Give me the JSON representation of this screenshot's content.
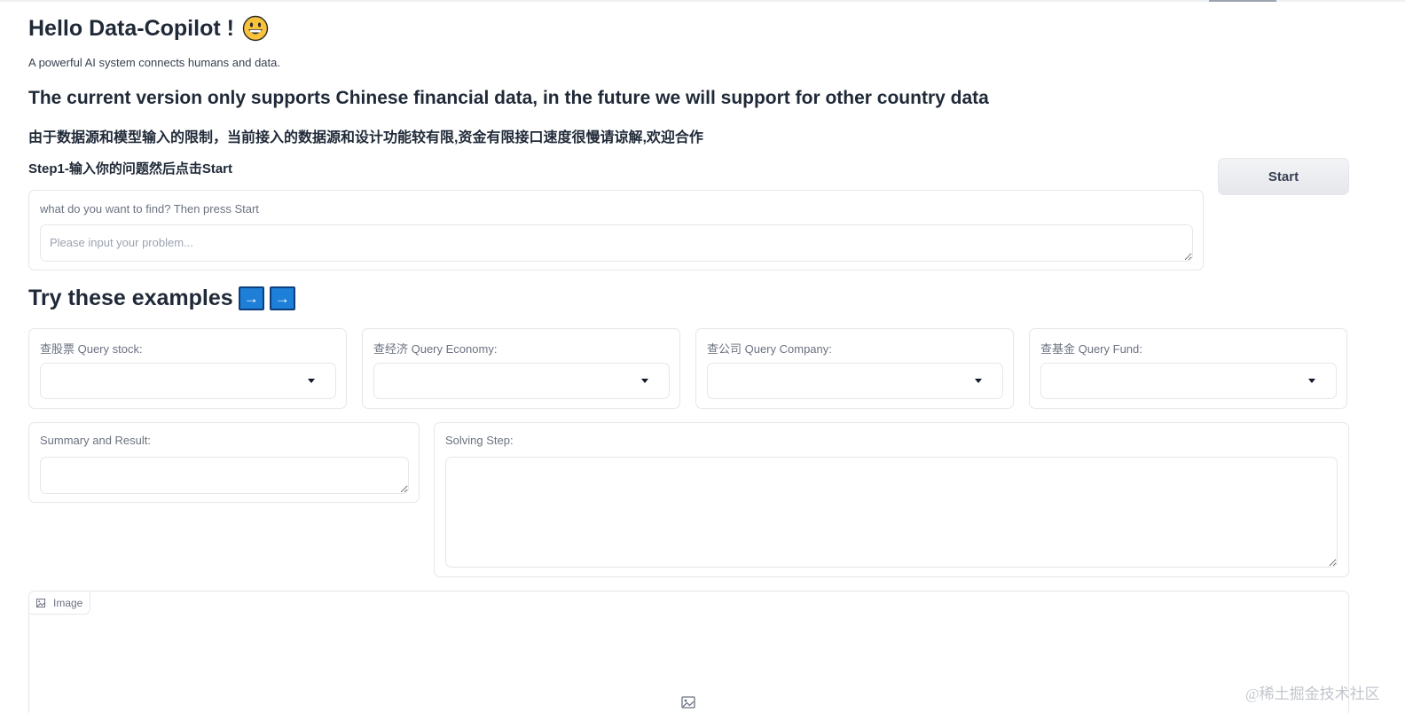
{
  "header": {
    "title": "Hello Data-Copilot !",
    "subtitle": "A powerful AI system connects humans and data.",
    "notice_en": "The current version only supports Chinese financial data, in the future we will support for other country data",
    "notice_zh": "由于数据源和模型输入的限制，当前接入的数据源和设计功能较有限,资金有限接口速度很慢请谅解,欢迎合作"
  },
  "step1": {
    "label": "Step1-输入你的问题然后点击Start",
    "start_label": "Start"
  },
  "query": {
    "label": "what do you want to find?   Then press Start",
    "placeholder": "Please input your problem...",
    "value": ""
  },
  "examples": {
    "title": "Try these examples",
    "arrow": "→",
    "dropdowns": [
      {
        "label": "查股票 Query stock:",
        "value": ""
      },
      {
        "label": "查经济 Query Economy:",
        "value": ""
      },
      {
        "label": "查公司 Query Company:",
        "value": ""
      },
      {
        "label": "查基金 Query Fund:",
        "value": ""
      }
    ]
  },
  "summary": {
    "label": "Summary and Result:",
    "value": ""
  },
  "solving": {
    "label": "Solving Step:",
    "value": ""
  },
  "image": {
    "tab_label": "Image"
  },
  "watermark": "@稀土掘金技术社区",
  "colors": {
    "arrow_box": "#1d7fd8",
    "border": "#e5e7eb",
    "button_bg": "#e5e7eb",
    "label_text": "#6b7280"
  },
  "icons": {
    "title_emoji": "grinning-face-icon",
    "arrow": "right-arrow-icon",
    "dropdown": "caret-down-icon",
    "image_tab": "image-icon",
    "image_placeholder": "image-placeholder-icon"
  }
}
